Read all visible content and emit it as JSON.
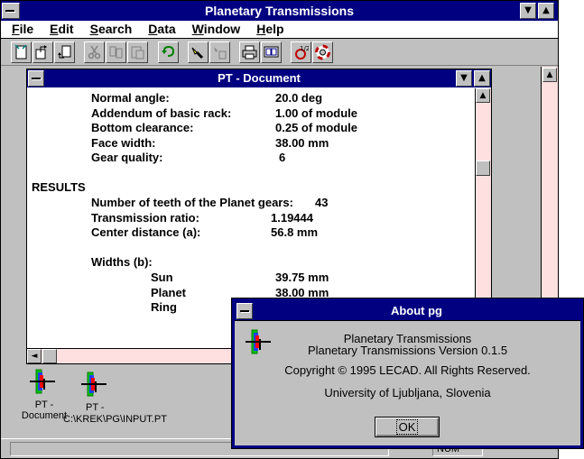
{
  "app": {
    "title": "Planetary Transmissions",
    "menu": [
      {
        "label": "File",
        "key": "F",
        "rest": "ile"
      },
      {
        "label": "Edit",
        "key": "E",
        "rest": "dit"
      },
      {
        "label": "Search",
        "key": "S",
        "rest": "earch"
      },
      {
        "label": "Data",
        "key": "D",
        "rest": "ata"
      },
      {
        "label": "Window",
        "key": "W",
        "rest": "indow"
      },
      {
        "label": "Help",
        "key": "H",
        "rest": "elp"
      }
    ],
    "status": {
      "mode": "NUM"
    }
  },
  "document": {
    "title": "PT - Document",
    "params": [
      {
        "label": "Normal angle:",
        "value": "20.0 deg"
      },
      {
        "label": "Addendum of basic rack:",
        "value": "1.00 of module"
      },
      {
        "label": "Bottom clearance:",
        "value": "0.25 of module"
      },
      {
        "label": "Face width:",
        "value": "38.00 mm"
      },
      {
        "label": "Gear quality:",
        "value": "6"
      }
    ],
    "results_heading": "RESULTS",
    "results": [
      {
        "label": "Number of teeth of the Planet gears:",
        "value": "43"
      },
      {
        "label": "Transmission ratio:",
        "value": "1.19444"
      },
      {
        "label": "Center distance (a):",
        "value": "56.8 mm"
      }
    ],
    "widths_heading": "Widths (b):",
    "widths": [
      {
        "label": "Sun",
        "value": "39.75 mm"
      },
      {
        "label": "Planet",
        "value": "38.00 mm"
      },
      {
        "label": "Ring",
        "value": ""
      }
    ]
  },
  "minimized": [
    {
      "line1": "PT -",
      "line2": "Document"
    },
    {
      "line1": "PT -",
      "line2": "C:\\KREK\\PG\\INPUT.PT"
    }
  ],
  "about": {
    "title": "About pg",
    "lines": [
      "Planetary Transmissions",
      "Planetary Transmissions Version 0.1.5",
      "Copyright © 1995 LECAD. All Rights Reserved.",
      "University of Ljubljana, Slovenia"
    ],
    "ok_label": "OK"
  }
}
